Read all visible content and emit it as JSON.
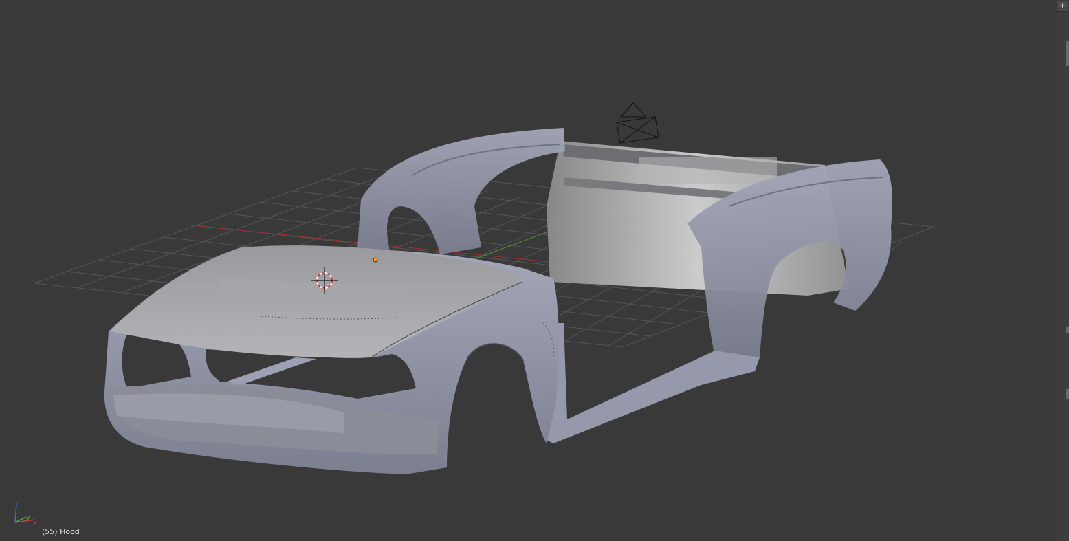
{
  "viewport": {
    "object_info": "(55) Hood",
    "corner_widget_symbol": "+",
    "axis_gizmo": {
      "x_label": "x",
      "y_label": "y",
      "x_color": "#d23c3c",
      "y_color": "#3cc23c",
      "z_color": "#3c6ed2"
    },
    "colors": {
      "background": "#393939",
      "grid": "#555555",
      "x_axis_line": "#9a3030",
      "y_axis_line": "#4d9a30",
      "mesh_fill": "#8f92a6",
      "mesh_shade": "#6d6f7d",
      "mesh_highlight": "#c9ccd6",
      "origin_dot": "#f0a040",
      "camera_outline": "#111111"
    },
    "icons": {
      "cursor": "3d-cursor-icon",
      "camera": "camera-icon",
      "origin": "object-origin-icon",
      "gizmo": "axis-gizmo-icon"
    }
  }
}
